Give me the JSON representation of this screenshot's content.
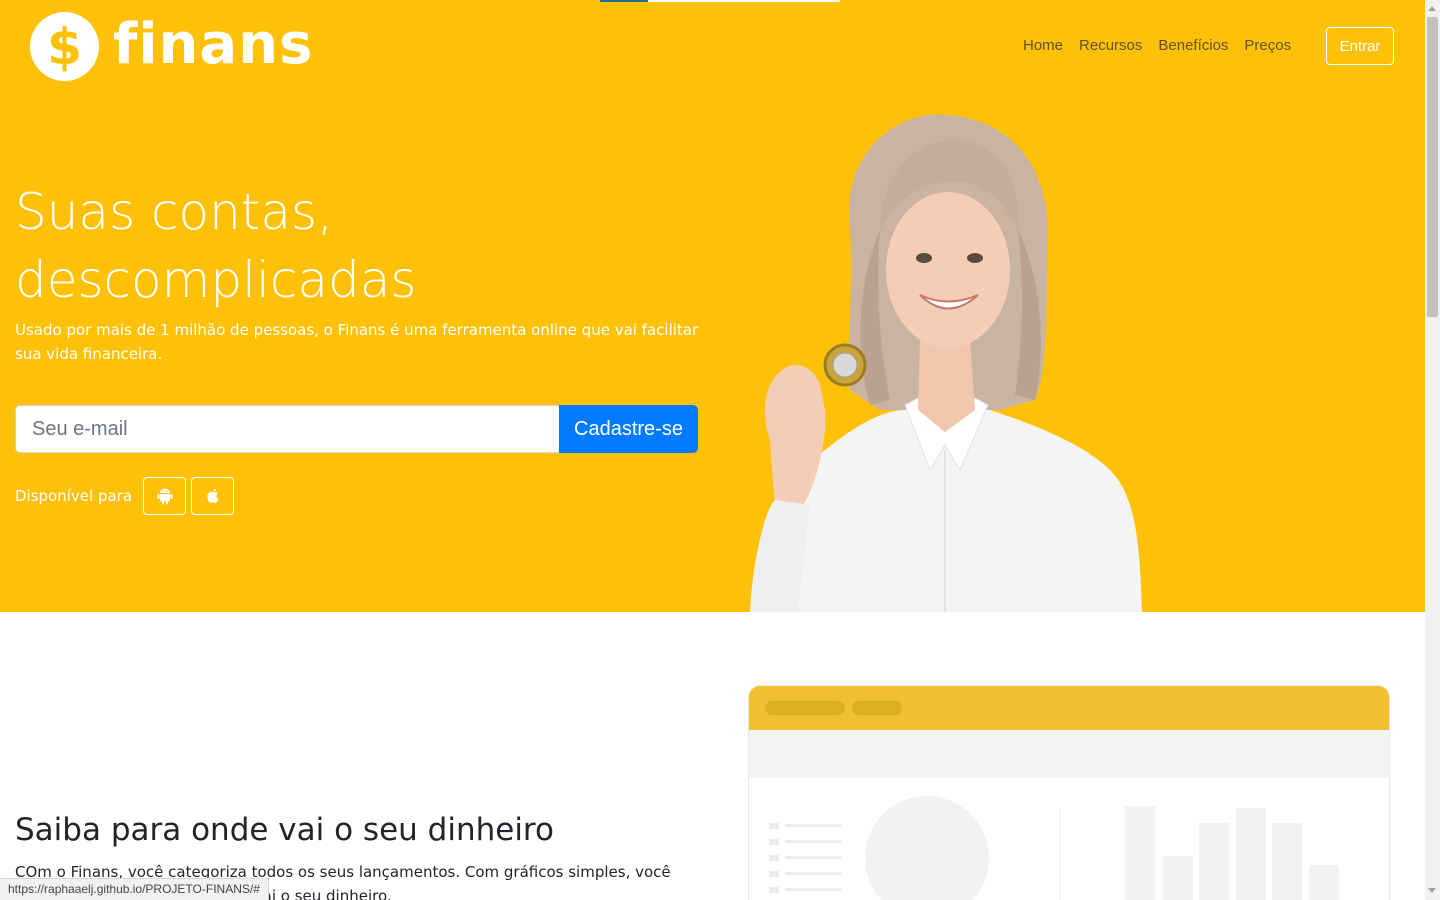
{
  "brand": {
    "name": "finans",
    "logo_symbol": "$"
  },
  "nav": {
    "items": [
      "Home",
      "Recursos",
      "Benefícios",
      "Preços"
    ],
    "login": "Entrar"
  },
  "hero": {
    "title_line1": "Suas contas,",
    "title_line2": "descomplicadas",
    "description": "Usado por mais de 1 milhão de pessoas, o Finans é uma ferramenta online que vai facilitar sua vida financeira.",
    "email_placeholder": "Seu e-mail",
    "signup_button": "Cadastre-se",
    "available_label": "Disponível para",
    "stores": [
      "android-icon",
      "apple-icon"
    ]
  },
  "section": {
    "title": "Saiba para onde vai o seu dinheiro",
    "description": "COm o Finans, você categoriza todos os seus lançamentos. Com gráficos simples, você sabe de onde vem e para onde vai o seu dinheiro."
  },
  "status_url": "https://raphaaelj.github.io/PROJETO-FINANS/#",
  "colors": {
    "hero_bg": "#ffc107",
    "primary": "#007bff",
    "mock_header": "#f0c030"
  }
}
